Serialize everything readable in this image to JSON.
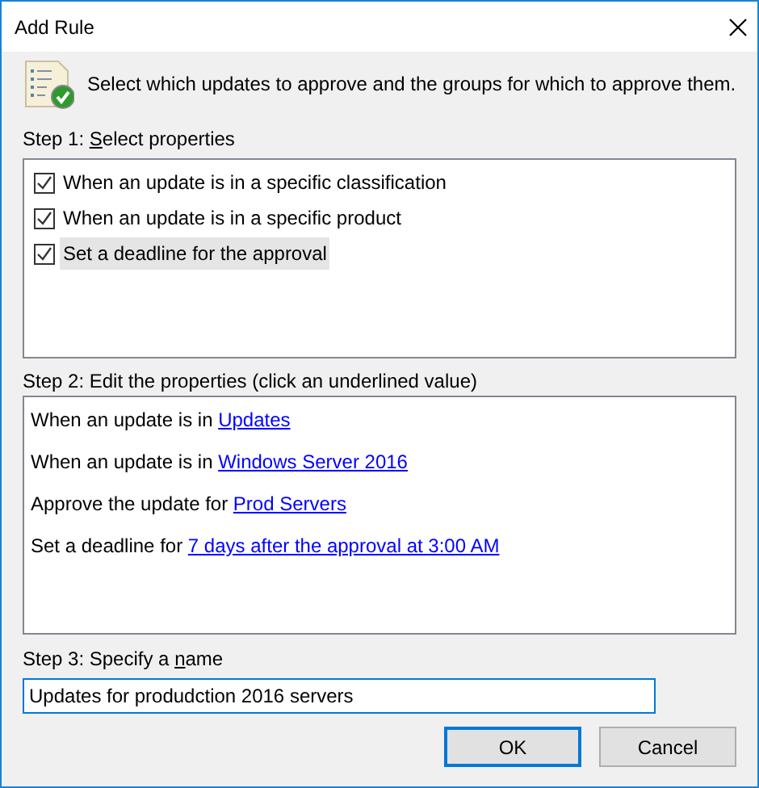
{
  "window": {
    "title": "Add Rule"
  },
  "intro": "Select which updates to approve and the groups for which to approve them.",
  "step1": {
    "label": {
      "before": "Step 1: ",
      "key": "S",
      "after": "elect properties"
    },
    "items": [
      {
        "label": "When an update is in a specific classification",
        "checked": true,
        "selected": false
      },
      {
        "label": "When an update is in a specific product",
        "checked": true,
        "selected": false
      },
      {
        "label": "Set a deadline for the approval",
        "checked": true,
        "selected": true
      }
    ]
  },
  "step2": {
    "label": "Step 2: Edit the properties (click an underlined value)",
    "lines": [
      {
        "text": "When an update is in ",
        "link": "Updates"
      },
      {
        "text": "When an update is in ",
        "link": "Windows Server 2016"
      },
      {
        "text": "Approve the update for ",
        "link": "Prod Servers"
      },
      {
        "text": "Set a deadline for ",
        "link": "7 days after the approval at 3:00 AM"
      }
    ]
  },
  "step3": {
    "label": {
      "before": "Step 3: Specify a ",
      "key": "n",
      "after": "ame"
    },
    "value": "Updates for produdction 2016 servers"
  },
  "buttons": [
    {
      "label": "OK",
      "default": true
    },
    {
      "label": "Cancel",
      "default": false
    }
  ]
}
